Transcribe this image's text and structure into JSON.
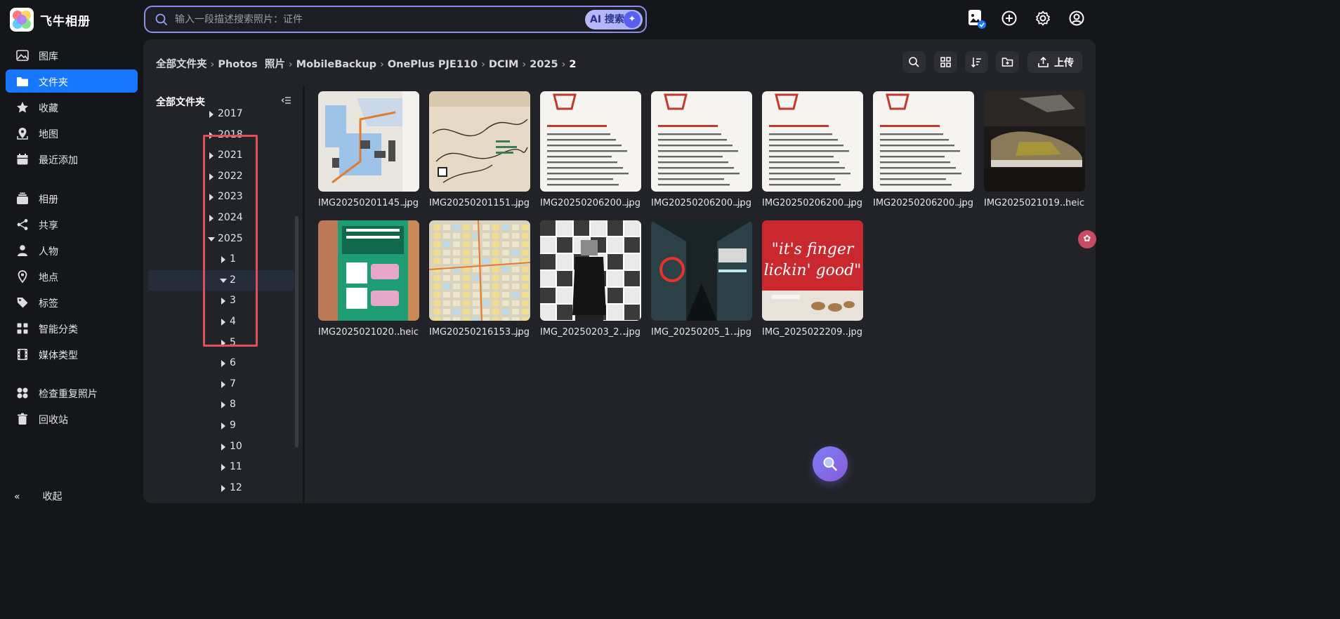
{
  "app": {
    "title": "飞牛相册"
  },
  "search": {
    "placeholder": "输入一段描述搜索照片：证件",
    "ai_label": "AI 搜索"
  },
  "top_icons": [
    "photo-badge-icon",
    "add-icon",
    "settings-icon",
    "user-icon"
  ],
  "sidebar": {
    "items": [
      {
        "label": "图库",
        "icon": "gallery-icon"
      },
      {
        "label": "文件夹",
        "icon": "folder-icon",
        "active": true
      },
      {
        "label": "收藏",
        "icon": "star-icon"
      },
      {
        "label": "地图",
        "icon": "map-icon"
      },
      {
        "label": "最近添加",
        "icon": "calendar-icon"
      },
      {
        "label": "相册",
        "icon": "album-icon"
      },
      {
        "label": "共享",
        "icon": "share-icon"
      },
      {
        "label": "人物",
        "icon": "person-icon"
      },
      {
        "label": "地点",
        "icon": "location-icon"
      },
      {
        "label": "标签",
        "icon": "tag-icon"
      },
      {
        "label": "智能分类",
        "icon": "smart-category-icon"
      },
      {
        "label": "媒体类型",
        "icon": "film-icon"
      },
      {
        "label": "检查重复照片",
        "icon": "duplicate-icon"
      },
      {
        "label": "回收站",
        "icon": "trash-icon"
      }
    ],
    "collapse_label": "收起"
  },
  "breadcrumb": [
    "全部文件夹",
    "Photos  照片",
    "MobileBackup",
    "OnePlus PJE110",
    "DCIM",
    "2025",
    "2"
  ],
  "toolbar": {
    "upload_label": "上传"
  },
  "tree": {
    "header": "全部文件夹",
    "rows": [
      {
        "label": "2017",
        "level": 0,
        "expanded": false
      },
      {
        "label": "2018",
        "level": 0,
        "expanded": false
      },
      {
        "label": "2021",
        "level": 0,
        "expanded": false
      },
      {
        "label": "2022",
        "level": 0,
        "expanded": false
      },
      {
        "label": "2023",
        "level": 0,
        "expanded": false
      },
      {
        "label": "2024",
        "level": 0,
        "expanded": false
      },
      {
        "label": "2025",
        "level": 0,
        "expanded": true
      },
      {
        "label": "1",
        "level": 1,
        "expanded": false
      },
      {
        "label": "2",
        "level": 1,
        "expanded": true,
        "selected": true
      },
      {
        "label": "3",
        "level": 1,
        "expanded": false
      },
      {
        "label": "4",
        "level": 1,
        "expanded": false
      },
      {
        "label": "5",
        "level": 1,
        "expanded": false
      },
      {
        "label": "6",
        "level": 1,
        "expanded": false
      },
      {
        "label": "7",
        "level": 1,
        "expanded": false
      },
      {
        "label": "8",
        "level": 1,
        "expanded": false
      },
      {
        "label": "9",
        "level": 1,
        "expanded": false
      },
      {
        "label": "10",
        "level": 1,
        "expanded": false
      },
      {
        "label": "11",
        "level": 1,
        "expanded": false
      },
      {
        "label": "12",
        "level": 1,
        "expanded": false
      }
    ]
  },
  "photos": [
    {
      "name": "IMG20250201145…",
      "ext": ".jpg",
      "kind": "map-blue"
    },
    {
      "name": "IMG20250201151…",
      "ext": ".jpg",
      "kind": "map-trail"
    },
    {
      "name": "IMG20250206200…",
      "ext": ".jpg",
      "kind": "text-page"
    },
    {
      "name": "IMG20250206200…",
      "ext": ".jpg",
      "kind": "text-page"
    },
    {
      "name": "IMG20250206200…",
      "ext": ".jpg",
      "kind": "text-page"
    },
    {
      "name": "IMG20250206200…",
      "ext": ".jpg",
      "kind": "text-page"
    },
    {
      "name": "IMG2025021019…",
      "ext": ".heic",
      "kind": "shoe"
    },
    {
      "name": "IMG2025021020…",
      "ext": ".heic",
      "kind": "green-sign"
    },
    {
      "name": "IMG20250216153…",
      "ext": ".jpg",
      "kind": "city-map"
    },
    {
      "name": "IMG_20250203_2…",
      "ext": ".jpg",
      "kind": "comic-wall"
    },
    {
      "name": "IMG_20250205_1…",
      "ext": ".jpg",
      "kind": "neon-street"
    },
    {
      "name": "IMG_2025022209…",
      "ext": ".jpg",
      "kind": "finger-lickin",
      "caption_art": "\"it's finger lickin' good\""
    }
  ]
}
